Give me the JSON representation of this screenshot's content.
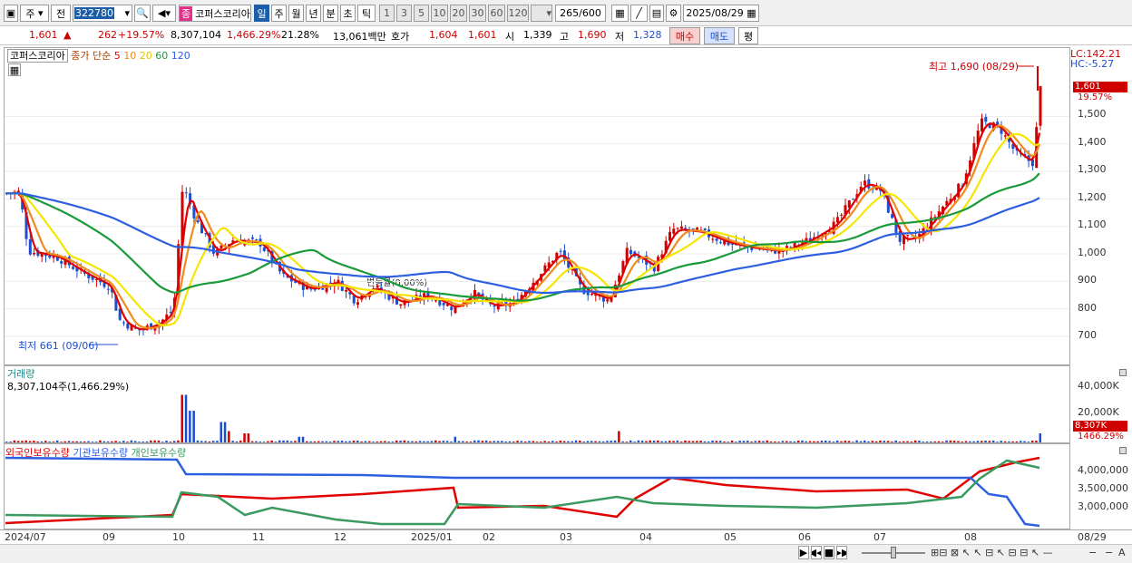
{
  "toolbar": {
    "jong": "주",
    "jeon": "전",
    "code": "322780",
    "badge": "종",
    "name": "코퍼스코리아",
    "periods": [
      "일",
      "주",
      "월",
      "년",
      "분",
      "초",
      "틱"
    ],
    "active_period": "일",
    "minute_steps": [
      "1",
      "3",
      "5",
      "10",
      "20",
      "30",
      "60",
      "120"
    ],
    "count": "265",
    "count_max": "/600",
    "date": "2025/08/29"
  },
  "quote": {
    "price": "1,601",
    "change": "262",
    "change_pct": "+19.57%",
    "volume": "8,307,104",
    "volume_pct": "1,466.29%",
    "turnover_pct": "21.28%",
    "amount": "13,061백만",
    "bid_label": "호가",
    "bid1": "1,604",
    "bid2": "1,601",
    "open_label": "시",
    "open": "1,339",
    "high_label": "고",
    "high": "1,690",
    "low_label": "저",
    "low": "1,328",
    "buy": "매수",
    "sell": "매도",
    "avg": "평"
  },
  "price_pane": {
    "title": "코퍼스코리아",
    "ma_label": "종가 단순",
    "ma_periods": [
      "5",
      "10",
      "20",
      "60",
      "120"
    ],
    "lc": "LC:142.21",
    "hc": "HC:-5.27",
    "high_marker": "최고 1,690 (08/29)",
    "low_marker": "최저 661 (09/06)",
    "change_marker": "변동률(0.00%)",
    "last_price": "1,601",
    "last_pct": "19.57%",
    "yticks": [
      "1,500",
      "1,400",
      "1,300",
      "1,200",
      "1,100",
      "1,000",
      "900",
      "800",
      "700"
    ]
  },
  "volume_pane": {
    "title": "거래량",
    "info": "8,307,104주(1,466.29%)",
    "yticks": [
      "40,000K",
      "20,000K"
    ],
    "last_vol": "8,307K",
    "last_pct": "1466.29%"
  },
  "holdings_pane": {
    "series": [
      "외국인보유수량",
      "기관보유수량",
      "개인보유수량"
    ],
    "yticks": [
      "4,000,000",
      "3,500,000",
      "3,000,000"
    ]
  },
  "xaxis": [
    "2024/07",
    "09",
    "10",
    "11",
    "12",
    "2025/01",
    "02",
    "03",
    "04",
    "05",
    "06",
    "07",
    "08",
    "08/29"
  ],
  "colors": {
    "up": "#d00000",
    "down": "#1c4fd0",
    "ma5": "#e00000",
    "ma10": "#f08c1e",
    "ma20": "#f5e600",
    "ma60": "#1a9a3a",
    "ma120": "#2e5fe0",
    "foreign": "#e00000",
    "institution": "#2e5fe0",
    "individual": "#3a9a60"
  }
}
